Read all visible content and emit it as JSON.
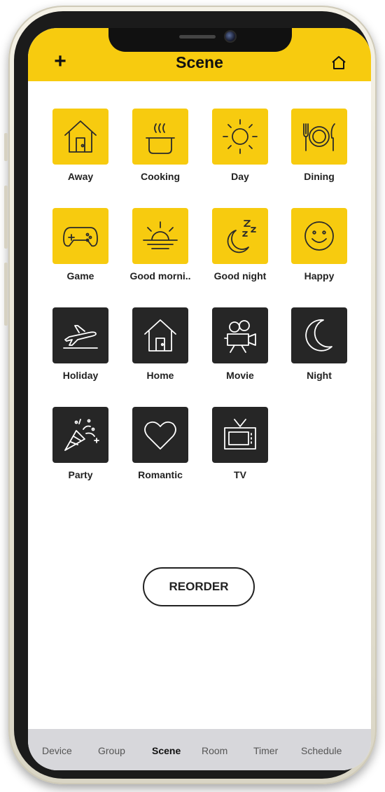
{
  "header": {
    "title": "Scene",
    "add_label": "+",
    "background": "#f7cb0f"
  },
  "scenes": [
    {
      "label": "Away",
      "icon": "house-door-icon",
      "style": "yellow"
    },
    {
      "label": "Cooking",
      "icon": "cooking-pot-icon",
      "style": "yellow"
    },
    {
      "label": "Day",
      "icon": "sun-icon",
      "style": "yellow"
    },
    {
      "label": "Dining",
      "icon": "plate-cutlery-icon",
      "style": "yellow"
    },
    {
      "label": "Game",
      "icon": "gamepad-icon",
      "style": "yellow"
    },
    {
      "label": "Good morni..",
      "icon": "sunrise-icon",
      "style": "yellow"
    },
    {
      "label": "Good night",
      "icon": "moon-zzz-icon",
      "style": "yellow"
    },
    {
      "label": "Happy",
      "icon": "smiley-icon",
      "style": "yellow"
    },
    {
      "label": "Holiday",
      "icon": "airplane-icon",
      "style": "dark"
    },
    {
      "label": "Home",
      "icon": "house-icon",
      "style": "dark"
    },
    {
      "label": "Movie",
      "icon": "movie-camera-icon",
      "style": "dark"
    },
    {
      "label": "Night",
      "icon": "crescent-moon-icon",
      "style": "dark"
    },
    {
      "label": "Party",
      "icon": "party-popper-icon",
      "style": "dark"
    },
    {
      "label": "Romantic",
      "icon": "heart-icon",
      "style": "dark"
    },
    {
      "label": "TV",
      "icon": "television-icon",
      "style": "dark"
    }
  ],
  "reorder_label": "REORDER",
  "tabs": [
    {
      "label": "Device",
      "active": false
    },
    {
      "label": "Group",
      "active": false
    },
    {
      "label": "Scene",
      "active": true
    },
    {
      "label": "Room",
      "active": false
    },
    {
      "label": "Timer",
      "active": false
    },
    {
      "label": "Schedule",
      "active": false
    }
  ],
  "colors": {
    "accent": "#f7cb0f",
    "dark_tile": "#262626",
    "tabbar": "#d7d7db"
  }
}
